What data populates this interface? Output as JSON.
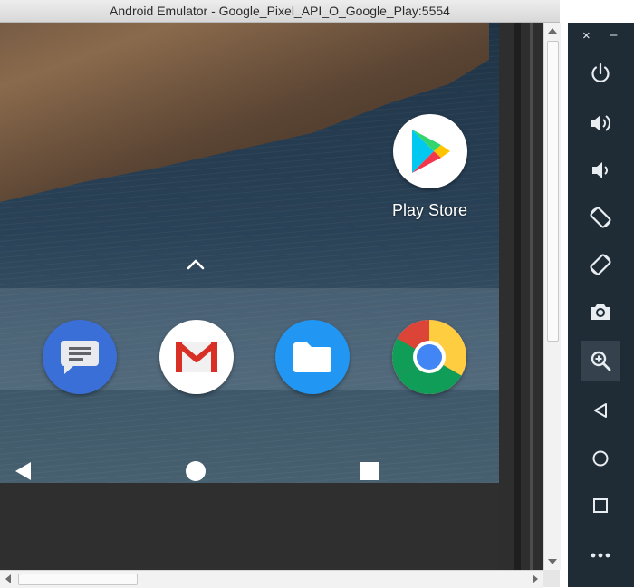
{
  "window": {
    "title": "Android Emulator - Google_Pixel_API_O_Google_Play:5554"
  },
  "home_screen": {
    "apps": [
      {
        "name": "Play Store",
        "icon": "play-store-icon"
      }
    ],
    "dock": [
      {
        "icon": "messages-icon"
      },
      {
        "icon": "gmail-icon"
      },
      {
        "icon": "files-icon"
      },
      {
        "icon": "chrome-icon"
      }
    ],
    "nav": [
      "back-icon",
      "home-icon",
      "recents-icon"
    ]
  },
  "toolbar": {
    "close": "×",
    "minimize": "–",
    "buttons": [
      "power-icon",
      "volume-up-icon",
      "volume-down-icon",
      "rotate-left-icon",
      "rotate-right-icon",
      "camera-icon",
      "zoom-icon",
      "back-icon",
      "home-icon",
      "overview-icon",
      "more-icon"
    ],
    "active": "zoom-icon"
  },
  "colors": {
    "toolbar_bg": "#1f2b35",
    "messages_blue": "#3b6fd8",
    "files_blue": "#2196f3",
    "gmail_red": "#d93025"
  }
}
